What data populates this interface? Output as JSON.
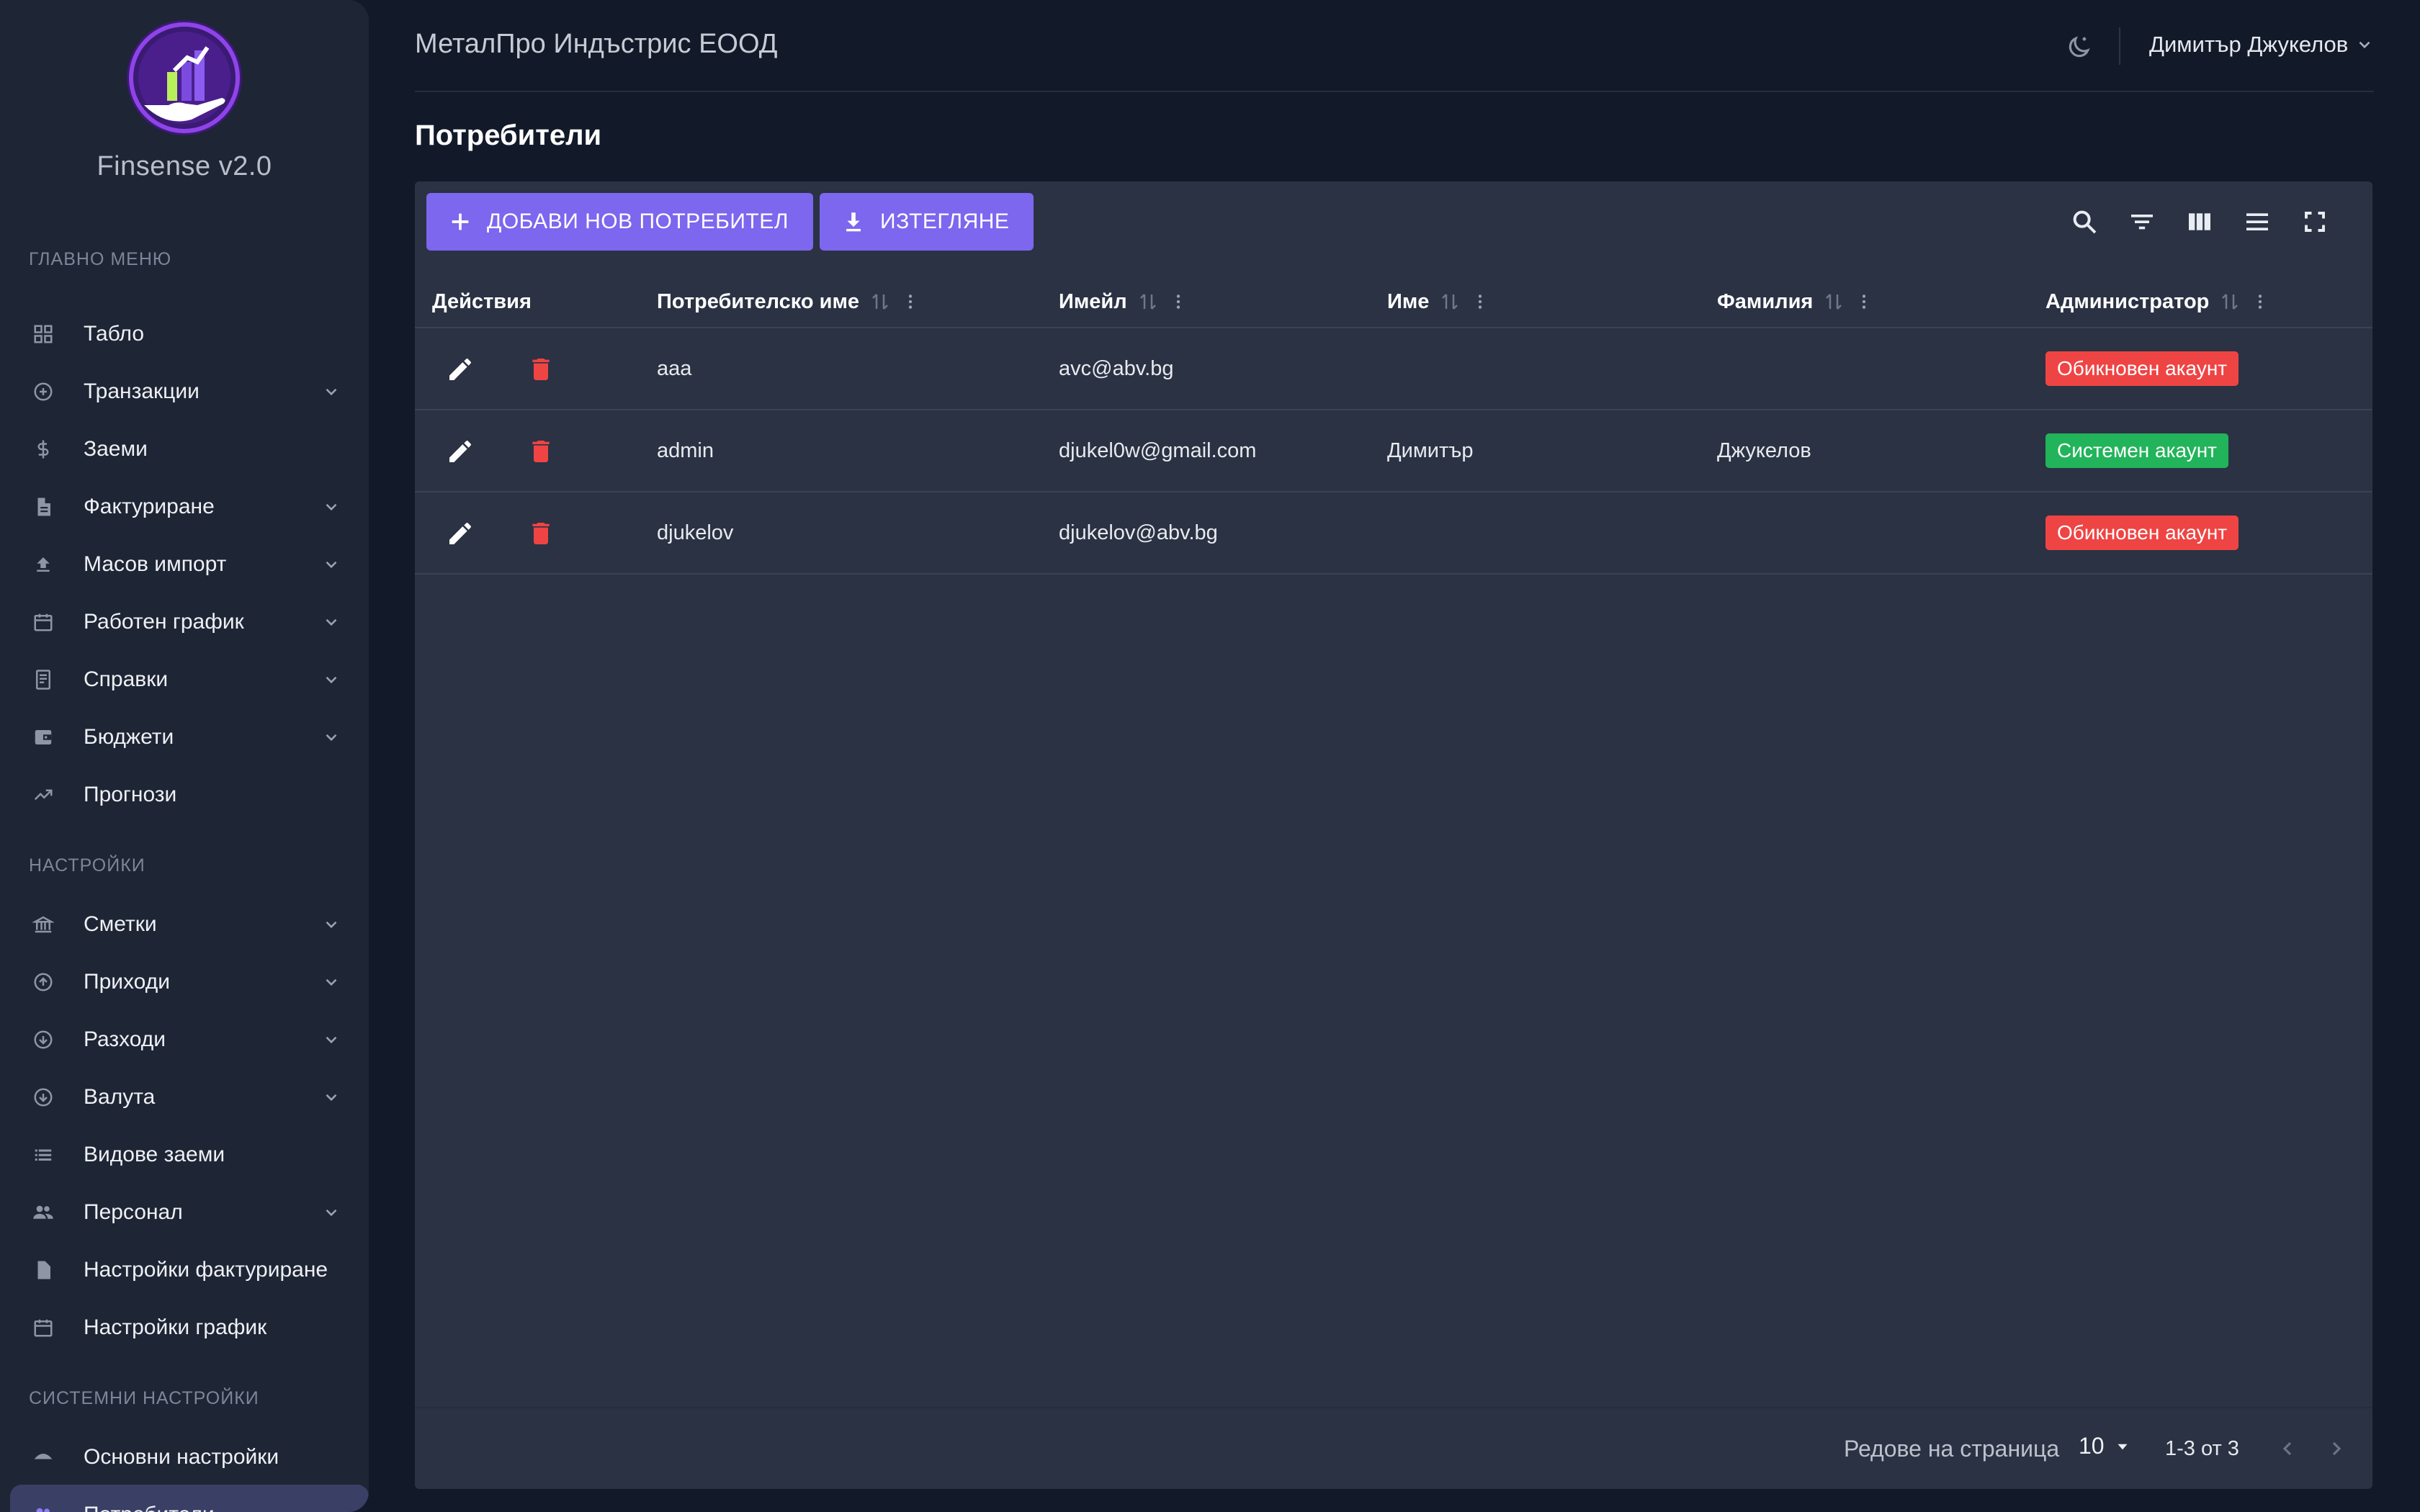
{
  "app": {
    "brand": "Finsense v2.0",
    "company": "МеталПро Индъстрис ЕООД",
    "user_name": "Димитър Джукелов"
  },
  "sidebar": {
    "main_title": "ГЛАВНО МЕНЮ",
    "main_items": [
      {
        "label": "Табло",
        "icon": "dashboard-icon",
        "expandable": false
      },
      {
        "label": "Транзакции",
        "icon": "add-circle-icon",
        "expandable": true
      },
      {
        "label": "Заеми",
        "icon": "dollar-icon",
        "expandable": false
      },
      {
        "label": "Фактуриране",
        "icon": "document-icon",
        "expandable": true
      },
      {
        "label": "Масов импорт",
        "icon": "upload-icon",
        "expandable": true
      },
      {
        "label": "Работен график",
        "icon": "calendar-icon",
        "expandable": true
      },
      {
        "label": "Справки",
        "icon": "receipt-icon",
        "expandable": true
      },
      {
        "label": "Бюджети",
        "icon": "wallet-icon",
        "expandable": true
      },
      {
        "label": "Прогнози",
        "icon": "trending-up-icon",
        "expandable": false
      }
    ],
    "settings_title": "НАСТРОЙКИ",
    "settings_items": [
      {
        "label": "Сметки",
        "icon": "bank-icon",
        "expandable": true
      },
      {
        "label": "Приходи",
        "icon": "arrow-up-circle-icon",
        "expandable": true
      },
      {
        "label": "Разходи",
        "icon": "arrow-down-circle-icon",
        "expandable": true
      },
      {
        "label": "Валута",
        "icon": "arrow-down-circle-icon",
        "expandable": true
      },
      {
        "label": "Видове заеми",
        "icon": "list-icon",
        "expandable": false
      },
      {
        "label": "Персонал",
        "icon": "people-icon",
        "expandable": true
      },
      {
        "label": "Настройки фактуриране",
        "icon": "document-icon",
        "expandable": false
      },
      {
        "label": "Настройки график",
        "icon": "calendar-icon",
        "expandable": false
      }
    ],
    "system_title": "СИСТЕМНИ НАСТРОЙКИ",
    "system_items": [
      {
        "label": "Основни настройки",
        "icon": "settings-dome-icon",
        "expandable": false
      },
      {
        "label": "Потребители",
        "icon": "people-icon",
        "expandable": false,
        "active": true
      }
    ]
  },
  "page": {
    "title": "Потребители"
  },
  "toolbar": {
    "add_label": "ДОБАВИ НОВ ПОТРЕБИТЕЛ",
    "export_label": "ИЗТЕГЛЯНЕ",
    "tools": [
      "search-icon",
      "filter-icon",
      "columns-icon",
      "density-icon",
      "fullscreen-icon"
    ]
  },
  "table": {
    "columns": [
      "Действия",
      "Потребителско име",
      "Имейл",
      "Име",
      "Фамилия",
      "Администратор"
    ],
    "rows": [
      {
        "username": "aaa",
        "email": "avc@abv.bg",
        "first_name": "",
        "last_name": "",
        "admin": "Обикновен акаунт",
        "admin_color": "#ef4444"
      },
      {
        "username": "admin",
        "email": "djukel0w@gmail.com",
        "first_name": "Димитър",
        "last_name": "Джукелов",
        "admin": "Системен акаунт",
        "admin_color": "#22b45a"
      },
      {
        "username": "djukelov",
        "email": "djukelov@abv.bg",
        "first_name": "",
        "last_name": "",
        "admin": "Обикновен акаунт",
        "admin_color": "#ef4444"
      }
    ]
  },
  "pagination": {
    "rows_per_page_label": "Редове на страница",
    "rows_per_page": "10",
    "range": "1-3 от 3"
  },
  "colors": {
    "accent": "#7c67ee",
    "danger": "#ef4444",
    "success": "#22b45a",
    "background": "#121a2a",
    "card": "#2a3243",
    "sidebar": "#1e2535"
  }
}
